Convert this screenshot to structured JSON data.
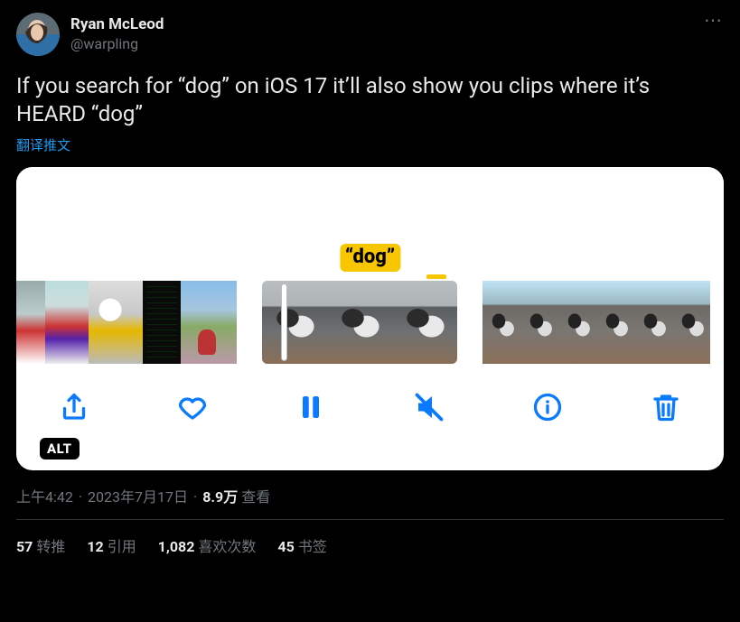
{
  "author": {
    "display_name": "Ryan McLeod",
    "handle": "@warpling"
  },
  "tweet_text": "If you search for “dog” on iOS 17 it’ll also show you clips where it’s HEARD “dog”",
  "translate_label": "翻译推文",
  "media": {
    "caption_label": "“dog”",
    "alt_badge": "ALT"
  },
  "meta": {
    "time": "上午4:42",
    "date": "2023年7月17日",
    "views_count": "8.9万",
    "views_label": "查看"
  },
  "stats": {
    "retweets": {
      "count": "57",
      "label": "转推"
    },
    "quotes": {
      "count": "12",
      "label": "引用"
    },
    "likes": {
      "count": "1,082",
      "label": "喜欢次数"
    },
    "bookmarks": {
      "count": "45",
      "label": "书签"
    }
  }
}
